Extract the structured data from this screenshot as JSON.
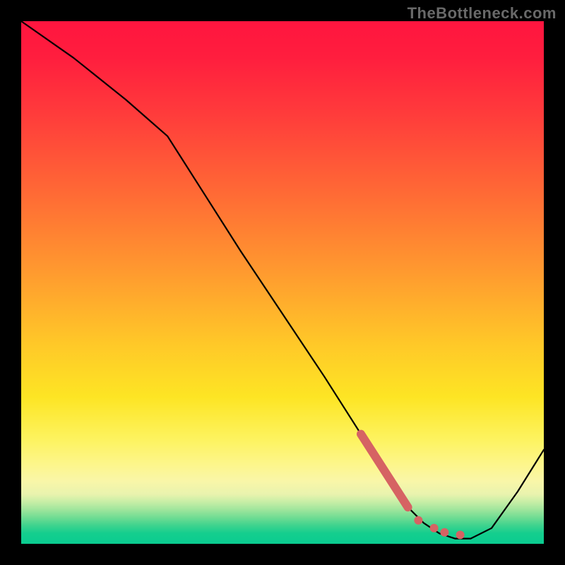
{
  "watermark": "TheBottleneck.com",
  "colors": {
    "highlight": "#d66363",
    "curve": "#000000",
    "frame": "#000000"
  },
  "chart_data": {
    "type": "line",
    "title": "",
    "xlabel": "",
    "ylabel": "",
    "xlim": [
      0,
      100
    ],
    "ylim": [
      0,
      100
    ],
    "grid": false,
    "legend": false,
    "background": "vertical-gradient-red-to-green",
    "series": [
      {
        "name": "bottleneck-curve",
        "x": [
          0,
          10,
          20,
          28,
          35,
          42,
          50,
          58,
          65,
          70,
          74,
          77,
          80,
          83,
          86,
          90,
          95,
          100
        ],
        "y": [
          100,
          93,
          85,
          78,
          67,
          56,
          44,
          32,
          21,
          13,
          7,
          4,
          2,
          1,
          1,
          3,
          10,
          18
        ]
      }
    ],
    "highlights": {
      "segment": {
        "x1": 65,
        "y1": 21,
        "x2": 74,
        "y2": 7
      },
      "dots": [
        {
          "x": 76,
          "y": 4.5
        },
        {
          "x": 79,
          "y": 3
        },
        {
          "x": 81,
          "y": 2.2
        },
        {
          "x": 84,
          "y": 1.7
        }
      ]
    }
  }
}
